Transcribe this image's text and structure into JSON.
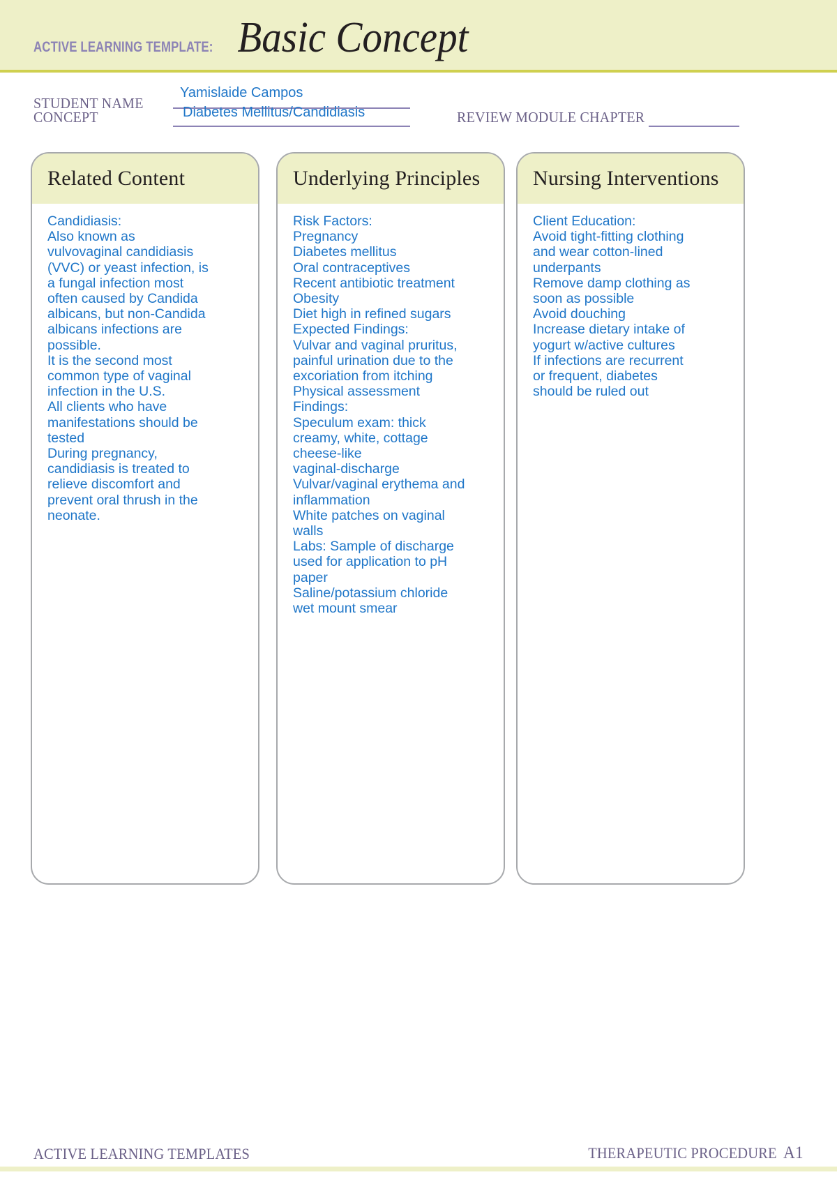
{
  "banner": {
    "template_label": "ACTIVE LEARNING TEMPLATE:",
    "template_title": "Basic Concept",
    "background_color": "#eef0c8",
    "accent_rule_color": "#cfd04f",
    "label_color": "#8c83b5"
  },
  "meta": {
    "student_name_label": "STUDENT NAME",
    "student_name_value": "Yamislaide Campos",
    "concept_label": "CONCEPT",
    "concept_value": "Diabetes Mellitus/Candidiasis",
    "review_module_label": "REVIEW MODULE CHAPTER",
    "review_module_value": "",
    "label_color": "#6b6188",
    "value_color": "#1f76c8",
    "rule_color": "#8c83b5"
  },
  "cards": [
    {
      "title": "Related Content",
      "lines": [
        "Candidiasis:",
        "Also known as",
        "vulvovaginal candidiasis",
        "(VVC) or yeast infection, is",
        "a fungal infection most",
        "often caused by Candida",
        "albicans, but non-Candida",
        "albicans infections are",
        "possible.",
        "It is the second most",
        "common type of vaginal",
        "infection in the U.S.",
        "All clients who have",
        "manifestations should be",
        "tested",
        "During pregnancy,",
        "candidiasis is treated to",
        "relieve discomfort and",
        "prevent oral thrush in the",
        "neonate."
      ]
    },
    {
      "title": "Underlying Principles",
      "lines": [
        "Risk Factors:",
        "Pregnancy",
        "Diabetes mellitus",
        "Oral contraceptives",
        "Recent antibiotic treatment",
        "Obesity",
        "Diet high in refined sugars",
        "Expected Findings:",
        "Vulvar and vaginal pruritus,",
        "painful urination due to the",
        "excoriation from itching",
        "Physical assessment",
        "Findings:",
        "Speculum exam: thick",
        "creamy, white, cottage",
        "cheese-like",
        "vaginal-discharge",
        "Vulvar/vaginal erythema and",
        "inflammation",
        "White patches on vaginal",
        "walls",
        "Labs: Sample of discharge",
        "used for application to pH",
        "paper",
        "Saline/potassium chloride",
        "wet mount smear"
      ]
    },
    {
      "title": "Nursing Interventions",
      "lines": [
        "Client Education:",
        "Avoid tight-fitting clothing",
        "and wear cotton-lined",
        "underpants",
        "Remove damp clothing as",
        "soon as possible",
        "Avoid douching",
        "Increase dietary intake of",
        "yogurt w/active cultures",
        "If infections are recurrent",
        "or frequent, diabetes",
        "should be ruled out"
      ]
    }
  ],
  "footer": {
    "left_text": "ACTIVE LEARNING TEMPLATES",
    "right_text": "THERAPEUTIC PROCEDURE",
    "page_code": "A1",
    "text_color": "#6b6188",
    "rule_color": "#eef0c8"
  }
}
